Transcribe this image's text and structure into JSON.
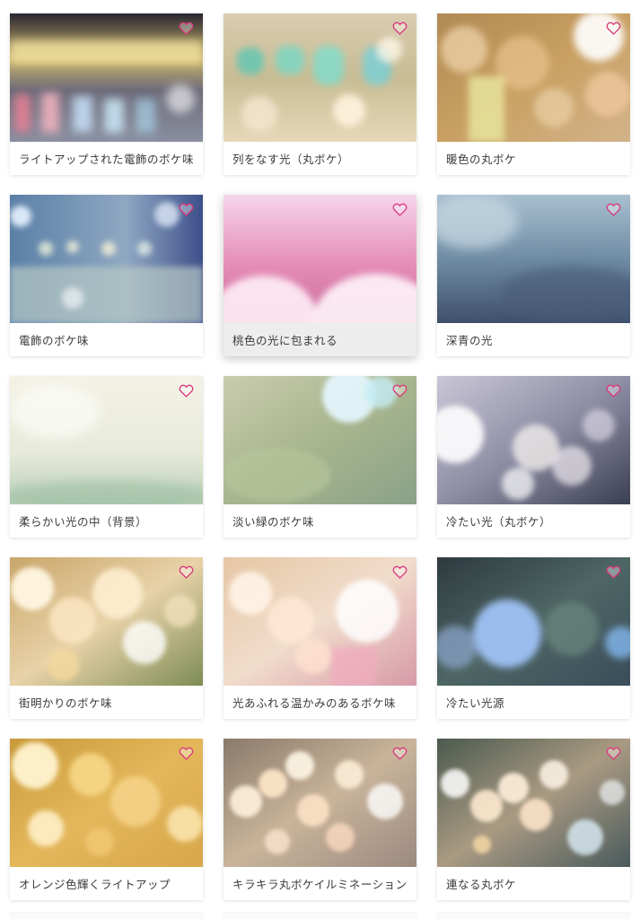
{
  "gallery": {
    "heart_color": "#d83a7c",
    "hovered_index": 4,
    "items": [
      {
        "caption": "ライトアップされた電飾のボケ味",
        "favorite": false,
        "icon": "heart-outline-icon"
      },
      {
        "caption": "列をなす光（丸ボケ）",
        "favorite": false,
        "icon": "heart-outline-icon"
      },
      {
        "caption": "暖色の丸ボケ",
        "favorite": false,
        "icon": "heart-outline-icon"
      },
      {
        "caption": "電飾のボケ味",
        "favorite": false,
        "icon": "heart-outline-icon"
      },
      {
        "caption": "桃色の光に包まれる",
        "favorite": false,
        "icon": "heart-outline-icon"
      },
      {
        "caption": "深青の光",
        "favorite": false,
        "icon": "heart-outline-icon"
      },
      {
        "caption": "柔らかい光の中（背景）",
        "favorite": false,
        "icon": "heart-outline-icon"
      },
      {
        "caption": "淡い緑のボケ味",
        "favorite": false,
        "icon": "heart-outline-icon"
      },
      {
        "caption": "冷たい光（丸ボケ）",
        "favorite": false,
        "icon": "heart-outline-icon"
      },
      {
        "caption": "街明かりのボケ味",
        "favorite": false,
        "icon": "heart-outline-icon"
      },
      {
        "caption": "光あふれる温かみのあるボケ味",
        "favorite": false,
        "icon": "heart-outline-icon"
      },
      {
        "caption": "冷たい光源",
        "favorite": false,
        "icon": "heart-outline-icon"
      },
      {
        "caption": "オレンジ色輝くライトアップ",
        "favorite": false,
        "icon": "heart-outline-icon"
      },
      {
        "caption": "キラキラ丸ボケイルミネーション",
        "favorite": false,
        "icon": "heart-outline-icon"
      },
      {
        "caption": "連なる丸ボケ",
        "favorite": false,
        "icon": "heart-outline-icon"
      }
    ]
  }
}
